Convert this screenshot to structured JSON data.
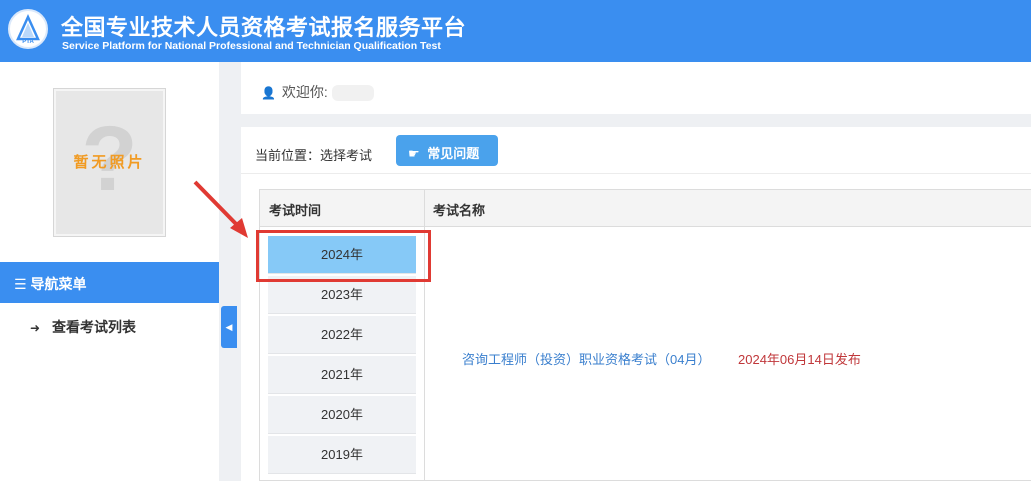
{
  "header": {
    "title": "全国专业技术人员资格考试报名服务平台",
    "subtitle": "Service Platform for National Professional and Technician Qualification Test"
  },
  "sidebar": {
    "photo_placeholder": "暂无照片",
    "nav_title": "导航菜单",
    "nav_items": [
      {
        "label": "查看考试列表"
      }
    ]
  },
  "welcome": {
    "label": "欢迎你:"
  },
  "breadcrumb": {
    "text": "当前位置：选择考试"
  },
  "faq_button": {
    "label": "常见问题"
  },
  "table": {
    "headers": [
      "考试时间",
      "考试名称"
    ],
    "years": [
      "2024年",
      "2023年",
      "2022年",
      "2021年",
      "2020年",
      "2019年"
    ],
    "selected_year": "2024年",
    "exams": [
      {
        "name": "咨询工程师（投资）职业资格考试（04月）",
        "published": "2024年06月14日发布"
      }
    ]
  },
  "colors": {
    "brand": "#3a8ef0",
    "active_year": "#86c9f7",
    "link": "#3a7fce",
    "date": "#c0373a",
    "highlight": "#e03a33"
  }
}
